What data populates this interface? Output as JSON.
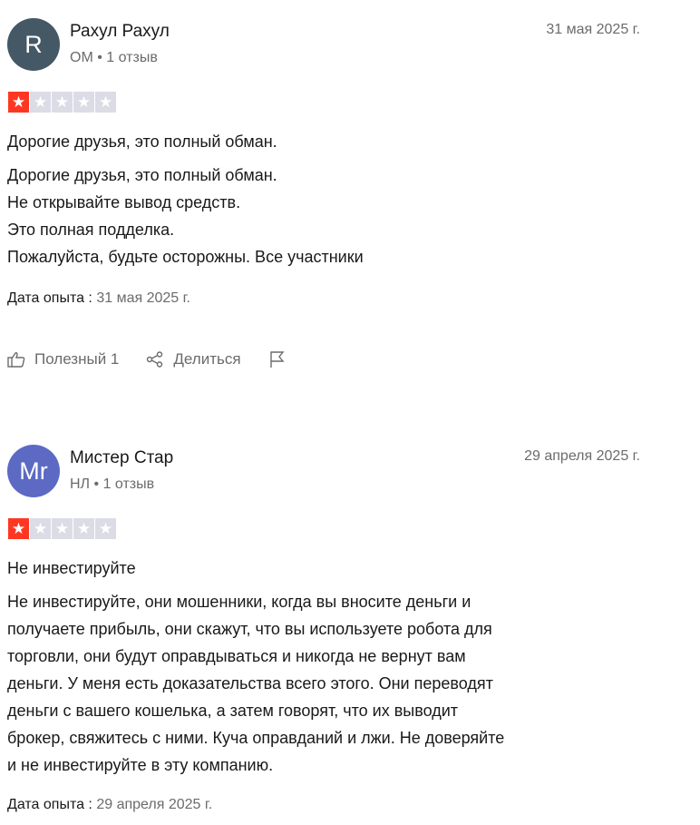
{
  "reviews": [
    {
      "avatar_letter": "R",
      "name": "Рахул Рахул",
      "country": "OM",
      "review_count": "1 отзыв",
      "date": "31 мая 2025 г.",
      "rating": 1,
      "title": "Дорогие друзья, это полный обман.",
      "body": "Дорогие друзья, это полный обман.\nНе открывайте вывод средств.\nЭто полная подделка.\nПожалуйста, будьте осторожны. Все участники",
      "experience_label": "Дата опыта :",
      "experience_date": "31 мая 2025 г.",
      "useful_label": "Полезный 1",
      "share_label": "Делиться"
    },
    {
      "avatar_letter": "Mr",
      "name": "Мистер Стар",
      "country": "НЛ",
      "review_count": "1 отзыв",
      "date": "29 апреля 2025 г.",
      "rating": 1,
      "title": "Не инвестируйте",
      "body": "Не инвестируйте, они мошенники, когда вы вносите деньги и\nполучаете прибыль, они скажут, что вы используете робота для\nторговли, они будут оправдываться и никогда не вернут вам\nденьги. У меня есть доказательства всего этого. Они переводят\nденьги с вашего кошелька, а затем говорят, что их выводит\nброкер, свяжитесь с ними. Куча оправданий и лжи. Не доверяйте\nи не инвестируйте в эту компанию.",
      "experience_label": "Дата опыта :",
      "experience_date": "29 апреля 2025 г."
    }
  ],
  "colors": {
    "star_filled": "#ff3722",
    "star_empty": "#dcdce6",
    "avatar1": "#445866",
    "avatar2": "#5c6ac4"
  },
  "icons": {
    "useful": "thumbs-up-icon",
    "share": "share-icon",
    "flag": "flag-icon",
    "star": "star-icon"
  }
}
